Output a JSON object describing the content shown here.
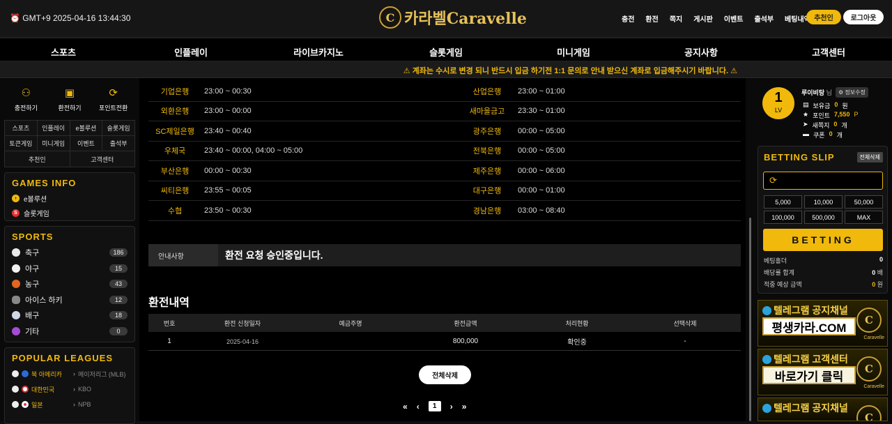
{
  "header": {
    "clock": "GMT+9 2025-04-16 13:44:30",
    "logo_mark": "C",
    "logo_text": "카라벨Caravelle",
    "nav": [
      "충전",
      "환전",
      "쪽지",
      "게시판",
      "이벤트",
      "출석부",
      "베팅내역"
    ],
    "recommend_label": "추천인",
    "logout_label": "로그아웃"
  },
  "main_nav": [
    "스포츠",
    "인플레이",
    "라이브카지노",
    "슬롯게임",
    "미니게임",
    "공지사항",
    "고객센터"
  ],
  "notice": "계좌는 수시로 변경 되니 반드시 입금 하기전 1:1 문의로 안내 받으신 계좌로 입금해주시기 바랍니다.",
  "left": {
    "quick": [
      {
        "icon": "piggy-bank-icon",
        "glyph": "⚇",
        "label": "충전하기"
      },
      {
        "icon": "cash-icon",
        "glyph": "▣",
        "label": "환전하기"
      },
      {
        "icon": "refresh-icon",
        "glyph": "⟳",
        "label": "포인트전환"
      }
    ],
    "grid": [
      [
        "스포츠",
        "인플레이",
        "e볼루션",
        "슬롯게임"
      ],
      [
        "토큰게임",
        "미니게임",
        "이벤트",
        "출석부"
      ],
      [
        "추천인",
        "고객센터"
      ]
    ],
    "games_info_title": "GAMES INFO",
    "games_info": [
      {
        "label": "e볼루션",
        "color": "#f0b90b",
        "glyph": "›"
      },
      {
        "label": "슬롯게임",
        "color": "#e03030",
        "glyph": "S"
      }
    ],
    "sports_title": "SPORTS",
    "sports": [
      {
        "label": "축구",
        "count": "186",
        "color": "#e8e8e8"
      },
      {
        "label": "야구",
        "count": "15",
        "color": "#f2f2f2"
      },
      {
        "label": "농구",
        "count": "43",
        "color": "#e2661f"
      },
      {
        "label": "아이스 하키",
        "count": "12",
        "color": "#888888"
      },
      {
        "label": "배구",
        "count": "18",
        "color": "#cfd8e6"
      },
      {
        "label": "기타",
        "count": "0",
        "color": "#a64bd6"
      }
    ],
    "leagues_title": "POPULAR LEAGUES",
    "leagues": [
      {
        "name": "북 아메리카",
        "sub": "메이저리그 (MLB)"
      },
      {
        "name": "대한민국",
        "sub": "KBO"
      },
      {
        "name": "일본",
        "sub": "NPB"
      }
    ]
  },
  "banks": [
    {
      "name": "기업은행",
      "time": "23:00 ~ 00:30",
      "name2": "산업은행",
      "time2": "23:00 ~ 01:00"
    },
    {
      "name": "외환은행",
      "time": "23:00 ~ 00:00",
      "name2": "새마을금고",
      "time2": "23:30 ~ 01:00"
    },
    {
      "name": "SC제일은행",
      "time": "23:40 ~ 00:40",
      "name2": "광주은행",
      "time2": "00:00 ~ 05:00"
    },
    {
      "name": "우체국",
      "time": "23:40 ~ 00:00, 04:00 ~ 05:00",
      "name2": "전북은행",
      "time2": "00:00 ~ 05:00"
    },
    {
      "name": "부산은행",
      "time": "00:00 ~ 00:30",
      "name2": "제주은행",
      "time2": "00:00 ~ 06:00"
    },
    {
      "name": "씨티은행",
      "time": "23:55 ~ 00:05",
      "name2": "대구은행",
      "time2": "00:00 ~ 01:00"
    },
    {
      "name": "수협",
      "time": "23:50 ~ 00:30",
      "name2": "경남은행",
      "time2": "03:00 ~ 08:40"
    }
  ],
  "info": {
    "label": "안내사항",
    "text": "환전 요청 승인중입니다."
  },
  "history": {
    "title": "환전내역",
    "headers": [
      "번호",
      "환전 신청일자",
      "예금주명",
      "환전금액",
      "처리현황",
      "선택삭제"
    ],
    "rows": [
      [
        "1",
        "2025-04-16",
        "",
        "800,000",
        "확인중",
        "-"
      ]
    ],
    "delete_all": "전체삭제"
  },
  "pager": {
    "first": "«",
    "prev": "‹",
    "page": "1",
    "next": "›",
    "last": "»"
  },
  "user": {
    "level": "1",
    "level_label": "LV",
    "name": "루이비탕",
    "honorific": "님",
    "edit_label": "정보수정",
    "stats": [
      {
        "label": "보유금",
        "value": "0",
        "unit": "원"
      },
      {
        "label": "포인트",
        "value": "7,550",
        "unit": "P"
      },
      {
        "label": "새쪽지",
        "value": "0",
        "unit": "개"
      },
      {
        "label": "쿠폰",
        "value": "0",
        "unit": "개"
      }
    ]
  },
  "slip": {
    "title": "BETTING SLIP",
    "clear": "전체삭제",
    "amounts": [
      "5,000",
      "10,000",
      "50,000",
      "100,000",
      "500,000",
      "MAX"
    ],
    "bet": "BETTING",
    "rows": [
      {
        "label": "베팅홀더",
        "value": "0",
        "unit": ""
      },
      {
        "label": "배당률 합계",
        "value": "0",
        "unit": "배"
      },
      {
        "label": "적중 예상 금액",
        "value": "0",
        "unit": "원"
      }
    ]
  },
  "banners": [
    {
      "top": "텔레그램 공지채널",
      "box": "평생카라.COM",
      "cap": "Caravelle"
    },
    {
      "top": "텔레그램 고객센터",
      "box": "바로가기 클릭",
      "cap": "Caravelle"
    },
    {
      "top": "텔레그램 공지채널",
      "box": "",
      "cap": ""
    }
  ]
}
